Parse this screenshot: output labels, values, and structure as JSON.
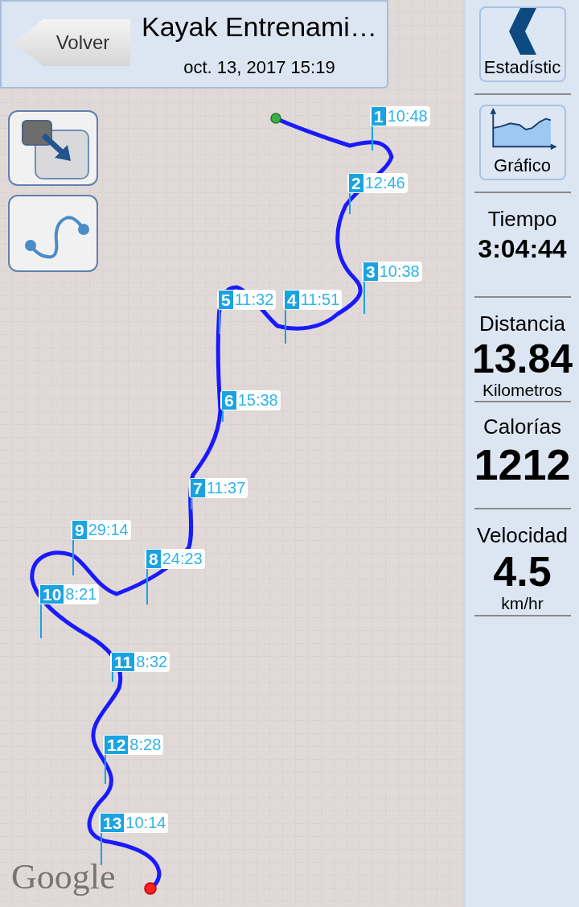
{
  "header": {
    "back_button": "Volver",
    "title": "Kayak Entrenami…",
    "subtitle": "oct. 13, 2017 15:19"
  },
  "laps": [
    {
      "number": "1",
      "time": "10:48"
    },
    {
      "number": "2",
      "time": "12:46"
    },
    {
      "number": "3",
      "time": "10:38"
    },
    {
      "number": "4",
      "time": "11:51"
    },
    {
      "number": "5",
      "time": "11:32"
    },
    {
      "number": "6",
      "time": "15:38"
    },
    {
      "number": "7",
      "time": "11:37"
    },
    {
      "number": "8",
      "time": "24:23"
    },
    {
      "number": "9",
      "time": "29:14"
    },
    {
      "number": "10",
      "time": "8:21"
    },
    {
      "number": "11",
      "time": "8:32"
    },
    {
      "number": "12",
      "time": "8:28"
    },
    {
      "number": "13",
      "time": "10:14"
    }
  ],
  "attribution": "Google",
  "sidebar": {
    "buttons": [
      {
        "kind": "back",
        "label": "Estadístic"
      },
      {
        "kind": "chart",
        "label": "Gráfico"
      }
    ],
    "stats": [
      {
        "label": "Tiempo",
        "value": "3:04:44"
      },
      {
        "label": "Distancia",
        "value": "13.84",
        "unit": "Kilometros"
      },
      {
        "label": "Calorías",
        "value": "1212"
      },
      {
        "label": "Velocidad",
        "value": "4.5",
        "unit": "km/hr"
      }
    ]
  }
}
